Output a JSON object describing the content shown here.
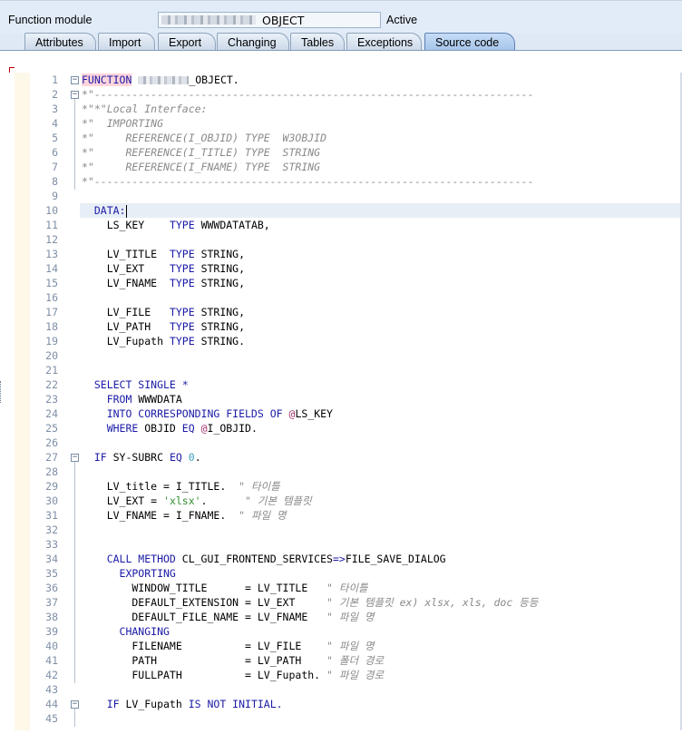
{
  "header": {
    "function_module_label": "Function module",
    "function_module_suffix": "OBJECT",
    "status": "Active"
  },
  "tabs": [
    {
      "label": "Attributes",
      "active": false
    },
    {
      "label": "Import",
      "active": false
    },
    {
      "label": "Export",
      "active": false
    },
    {
      "label": "Changing",
      "active": false
    },
    {
      "label": "Tables",
      "active": false
    },
    {
      "label": "Exceptions",
      "active": false
    },
    {
      "label": "Source code",
      "active": true
    }
  ],
  "editor": {
    "cursor_line": 10,
    "lines": [
      {
        "n": "1",
        "fold": "minus",
        "segs": [
          {
            "t": "FUNCTION",
            "c": "fn-hl"
          },
          {
            "t": " ",
            "c": ""
          },
          {
            "t": "",
            "c": "blur"
          },
          {
            "t": "_OBJECT.",
            "c": ""
          }
        ]
      },
      {
        "n": "2",
        "fold": "minus",
        "segs": [
          {
            "t": "*\"----------------------------------------------------------------------",
            "c": "cm"
          }
        ]
      },
      {
        "n": "3",
        "segs": [
          {
            "t": "*\"*\"Local Interface:",
            "c": "cm"
          }
        ]
      },
      {
        "n": "4",
        "segs": [
          {
            "t": "*\"  IMPORTING",
            "c": "cm"
          }
        ]
      },
      {
        "n": "5",
        "segs": [
          {
            "t": "*\"     REFERENCE(I_OBJID) TYPE  W3OBJID",
            "c": "cm"
          }
        ]
      },
      {
        "n": "6",
        "segs": [
          {
            "t": "*\"     REFERENCE(I_TITLE) TYPE  STRING",
            "c": "cm"
          }
        ]
      },
      {
        "n": "7",
        "segs": [
          {
            "t": "*\"     REFERENCE(I_FNAME) TYPE  STRING",
            "c": "cm"
          }
        ]
      },
      {
        "n": "8",
        "segs": [
          {
            "t": "*\"----------------------------------------------------------------------",
            "c": "cm"
          }
        ]
      },
      {
        "n": "9",
        "segs": []
      },
      {
        "n": "10",
        "segs": [
          {
            "t": "  DATA:",
            "c": "kw"
          },
          {
            "t": "",
            "c": "caret"
          }
        ]
      },
      {
        "n": "11",
        "segs": [
          {
            "t": "    LS_KEY    ",
            "c": ""
          },
          {
            "t": "TYPE",
            "c": "kw"
          },
          {
            "t": " WWWDATATAB,",
            "c": ""
          }
        ]
      },
      {
        "n": "12",
        "segs": []
      },
      {
        "n": "13",
        "segs": [
          {
            "t": "    LV_TITLE  ",
            "c": ""
          },
          {
            "t": "TYPE",
            "c": "kw"
          },
          {
            "t": " STRING,",
            "c": ""
          }
        ]
      },
      {
        "n": "14",
        "segs": [
          {
            "t": "    LV_EXT    ",
            "c": ""
          },
          {
            "t": "TYPE",
            "c": "kw"
          },
          {
            "t": " STRING,",
            "c": ""
          }
        ]
      },
      {
        "n": "15",
        "segs": [
          {
            "t": "    LV_FNAME  ",
            "c": ""
          },
          {
            "t": "TYPE",
            "c": "kw"
          },
          {
            "t": " STRING,",
            "c": ""
          }
        ]
      },
      {
        "n": "16",
        "segs": []
      },
      {
        "n": "17",
        "segs": [
          {
            "t": "    LV_FILE   ",
            "c": ""
          },
          {
            "t": "TYPE",
            "c": "kw"
          },
          {
            "t": " STRING,",
            "c": ""
          }
        ]
      },
      {
        "n": "18",
        "segs": [
          {
            "t": "    LV_PATH   ",
            "c": ""
          },
          {
            "t": "TYPE",
            "c": "kw"
          },
          {
            "t": " STRING,",
            "c": ""
          }
        ]
      },
      {
        "n": "19",
        "segs": [
          {
            "t": "    LV_Fupath ",
            "c": ""
          },
          {
            "t": "TYPE",
            "c": "kw"
          },
          {
            "t": " STRING.",
            "c": ""
          }
        ]
      },
      {
        "n": "20",
        "segs": []
      },
      {
        "n": "21",
        "segs": []
      },
      {
        "n": "22",
        "segs": [
          {
            "t": "  SELECT SINGLE *",
            "c": "kw"
          }
        ]
      },
      {
        "n": "23",
        "segs": [
          {
            "t": "    FROM",
            "c": "kw"
          },
          {
            "t": " WWWDATA",
            "c": ""
          }
        ]
      },
      {
        "n": "24",
        "segs": [
          {
            "t": "    INTO CORRESPONDING FIELDS OF",
            "c": "kw"
          },
          {
            "t": " ",
            "c": ""
          },
          {
            "t": "@",
            "c": "at"
          },
          {
            "t": "LS_KEY",
            "c": ""
          }
        ]
      },
      {
        "n": "25",
        "segs": [
          {
            "t": "    WHERE",
            "c": "kw"
          },
          {
            "t": " OBJID ",
            "c": ""
          },
          {
            "t": "EQ",
            "c": "kw"
          },
          {
            "t": " ",
            "c": ""
          },
          {
            "t": "@",
            "c": "at"
          },
          {
            "t": "I_OBJID.",
            "c": ""
          }
        ]
      },
      {
        "n": "26",
        "segs": []
      },
      {
        "n": "27",
        "fold": "minus",
        "segs": [
          {
            "t": "  IF",
            "c": "kw"
          },
          {
            "t": " SY-SUBRC ",
            "c": ""
          },
          {
            "t": "EQ",
            "c": "kw"
          },
          {
            "t": " ",
            "c": ""
          },
          {
            "t": "0",
            "c": "num"
          },
          {
            "t": ".",
            "c": ""
          }
        ]
      },
      {
        "n": "28",
        "segs": []
      },
      {
        "n": "29",
        "segs": [
          {
            "t": "    LV_title = I_TITLE.  ",
            "c": ""
          },
          {
            "t": "\" 타이틀",
            "c": "cm"
          }
        ]
      },
      {
        "n": "30",
        "segs": [
          {
            "t": "    LV_EXT = ",
            "c": ""
          },
          {
            "t": "'xlsx'",
            "c": "str"
          },
          {
            "t": ".      ",
            "c": ""
          },
          {
            "t": "\" 기본 템플릿",
            "c": "cm"
          }
        ]
      },
      {
        "n": "31",
        "segs": [
          {
            "t": "    LV_FNAME = I_FNAME.  ",
            "c": ""
          },
          {
            "t": "\" 파일 명",
            "c": "cm"
          }
        ]
      },
      {
        "n": "32",
        "segs": []
      },
      {
        "n": "33",
        "segs": []
      },
      {
        "n": "34",
        "segs": [
          {
            "t": "    CALL METHOD",
            "c": "kw"
          },
          {
            "t": " CL_GUI_FRONTEND_SERVICES",
            "c": ""
          },
          {
            "t": "=>",
            "c": "kw"
          },
          {
            "t": "FILE_SAVE_DIALOG",
            "c": ""
          }
        ]
      },
      {
        "n": "35",
        "segs": [
          {
            "t": "      EXPORTING",
            "c": "kw"
          }
        ]
      },
      {
        "n": "36",
        "segs": [
          {
            "t": "        WINDOW_TITLE      = LV_TITLE   ",
            "c": ""
          },
          {
            "t": "\" 타이틀",
            "c": "cm"
          }
        ]
      },
      {
        "n": "37",
        "segs": [
          {
            "t": "        DEFAULT_EXTENSION = LV_EXT     ",
            "c": ""
          },
          {
            "t": "\" 기본 템플릿 ex) xlsx, xls, doc 등등",
            "c": "cm"
          }
        ]
      },
      {
        "n": "38",
        "segs": [
          {
            "t": "        DEFAULT_FILE_NAME = LV_FNAME   ",
            "c": ""
          },
          {
            "t": "\" 파일 명",
            "c": "cm"
          }
        ]
      },
      {
        "n": "39",
        "segs": [
          {
            "t": "      CHANGING",
            "c": "kw"
          }
        ]
      },
      {
        "n": "40",
        "segs": [
          {
            "t": "        FILENAME          = LV_FILE    ",
            "c": ""
          },
          {
            "t": "\" 파일 명",
            "c": "cm"
          }
        ]
      },
      {
        "n": "41",
        "segs": [
          {
            "t": "        PATH              = LV_PATH    ",
            "c": ""
          },
          {
            "t": "\" 폴더 경로",
            "c": "cm"
          }
        ]
      },
      {
        "n": "42",
        "segs": [
          {
            "t": "        FULLPATH          = LV_Fupath. ",
            "c": ""
          },
          {
            "t": "\" 파일 경로",
            "c": "cm"
          }
        ]
      },
      {
        "n": "43",
        "segs": []
      },
      {
        "n": "44",
        "fold": "minus",
        "segs": [
          {
            "t": "    IF",
            "c": "kw"
          },
          {
            "t": " LV_Fupath ",
            "c": ""
          },
          {
            "t": "IS NOT INITIAL.",
            "c": "kw"
          }
        ]
      },
      {
        "n": "45",
        "segs": []
      }
    ]
  }
}
